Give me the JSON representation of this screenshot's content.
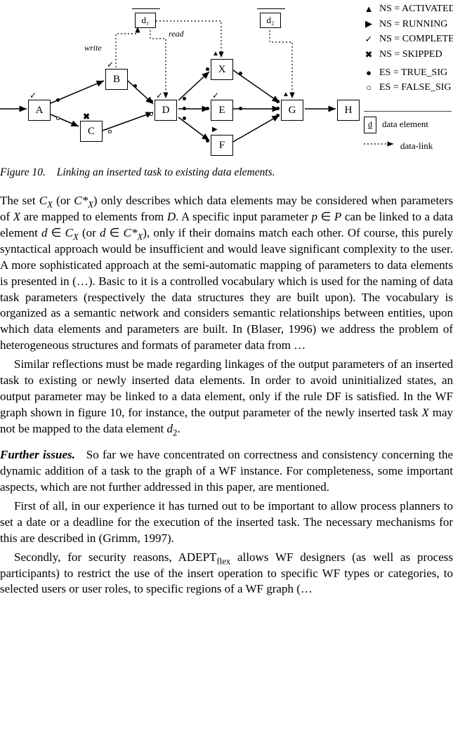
{
  "figure": {
    "nodes": {
      "A": "A",
      "B": "B",
      "C": "C",
      "D": "D",
      "X": "X",
      "E": "E",
      "F": "F",
      "G": "G",
      "H": "H"
    },
    "data": {
      "d1": "d₁",
      "d2": "d₂"
    },
    "annotations": {
      "write": "write",
      "read": "read"
    },
    "legend": {
      "activated": "NS = ACTIVATED",
      "running": "NS = RUNNING",
      "completed": "NS = COMPLETED",
      "skipped": "NS = SKIPPED",
      "true_sig": "ES = TRUE_SIG",
      "false_sig": "ES = FALSE_SIG",
      "data_element": "data element",
      "data_link": "data-link"
    },
    "d_label": "d"
  },
  "caption": {
    "num": "Figure 10.",
    "text": "Linking an inserted task to existing data elements."
  },
  "para1": "The set C_X (or C*_X) only describes which data elements may be considered when parameters of X are mapped to elements from D. A specific input parameter p ∈ P can be linked to a data element d ∈ C_X (or d ∈ C*_X), only if their domains match each other. Of course, this purely syntactical approach would be insufficient and would leave significant complexity to the user. A more sophisticated approach at the semi-automatic mapping of parameters to data elements is presented in (…). Basic to it is a controlled vocabulary which is used for the naming of data task parameters (respectively the data structures they are built upon). The vocabulary is organized as a semantic network and considers semantic relationships between entities, upon which data elements and parameters are built. In (Blaser, 1996) we address the problem of heterogeneous structures and formats of parameter data from …",
  "para2": "Similar reflections must be made regarding linkages of the output parameters of an inserted task to existing or newly inserted data elements. In order to avoid uninitialized states, an output parameter may be linked to a data element, only if the rule DF is satisfied. In the WF graph shown in figure 10, for instance, the output parameter of the newly inserted task X may not be mapped to the data element d₂.",
  "para3_label": "Further issues.",
  "para3": "So far we have concentrated on correctness and consistency concerning the dynamic addition of a task to the graph of a WF instance. For completeness, some important aspects, which are not further addressed in this paper, are mentioned.",
  "para4": "First of all, in our experience it has turned out to be important to allow process planners to set a date or a deadline for the execution of the inserted task. The necessary mechanisms for this are described in (Grimm, 1997).",
  "para5": "Secondly, for security reasons, ADEPT_flex allows WF designers (as well as process participants) to restrict the use of the insert operation to specific WF types or categories, to selected users or user roles, to specific regions of a WF graph (…"
}
